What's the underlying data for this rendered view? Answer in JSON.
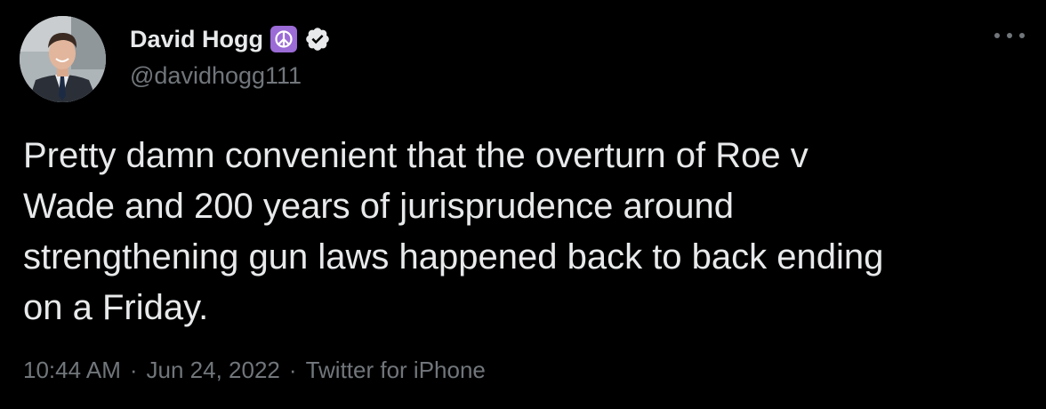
{
  "author": {
    "display_name": "David Hogg",
    "handle": "@davidhogg111",
    "badge_emoji_icon": "peace-symbol-icon",
    "verified_icon": "verified-badge-icon",
    "avatar": "avatar-photo"
  },
  "tweet": {
    "text": "Pretty damn convenient that the overturn of Roe v\nWade and 200 years of jurisprudence around\nstrengthening gun laws happened back to back ending\non a Friday."
  },
  "meta": {
    "time": "10:44 AM",
    "sep1": "·",
    "date": "Jun 24, 2022",
    "sep2": "·",
    "source": "Twitter for iPhone"
  },
  "colors": {
    "background": "#000000",
    "text": "#e7e9ea",
    "secondary": "#71767b",
    "peace_badge": "#9b6bd6"
  }
}
